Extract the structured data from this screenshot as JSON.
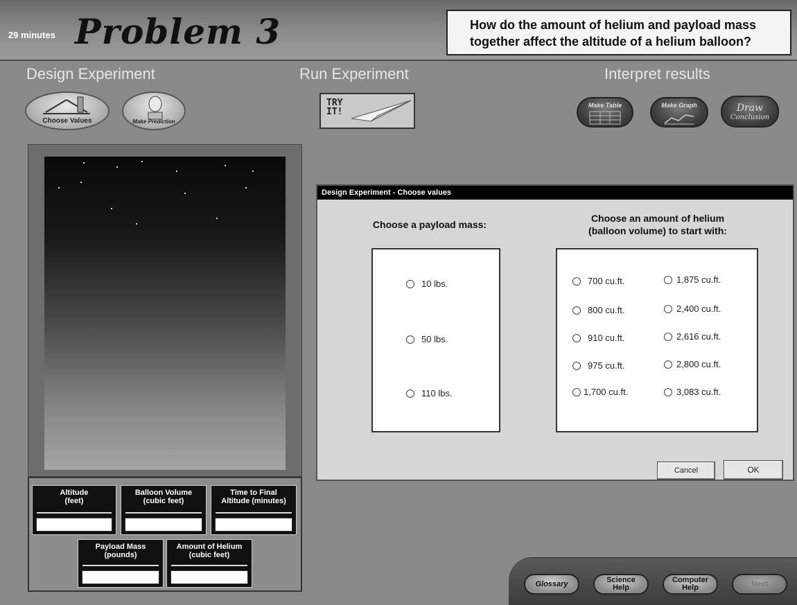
{
  "header": {
    "timer": "29 minutes",
    "title": "Problem 3",
    "question_line1": "How do the amount of helium and payload mass",
    "question_line2": "together affect the altitude of a helium balloon?"
  },
  "sections": {
    "design": {
      "title": "Design  Experiment",
      "choose_values": "Choose Values",
      "make_prediction": "Make Prediction"
    },
    "run": {
      "title": "Run  Experiment",
      "try_it_line1": "TRY",
      "try_it_line2": "IT!"
    },
    "interpret": {
      "title": "Interpret results",
      "make_table": "Make Table",
      "make_graph": "Make Graph",
      "draw_conclusion_line1": "Draw",
      "draw_conclusion_line2": "Conclusion"
    }
  },
  "readouts": {
    "altitude": {
      "line1": "Altitude",
      "line2": "(feet)",
      "value": ""
    },
    "balloon_volume": {
      "line1": "Balloon Volume",
      "line2": "(cubic feet)",
      "value": ""
    },
    "time_to_final": {
      "line1": "Time to Final",
      "line2": "Altitude (minutes)",
      "value": ""
    },
    "payload_mass": {
      "line1": "Payload Mass",
      "line2": "(pounds)",
      "value": ""
    },
    "amount_of_helium": {
      "line1": "Amount of Helium",
      "line2": "(cubic feet)",
      "value": ""
    }
  },
  "dialog": {
    "title": "Design Experiment - Choose values",
    "payload_heading": "Choose a payload mass:",
    "helium_heading_line1": "Choose an amount of helium",
    "helium_heading_line2": "(balloon volume) to start with:",
    "payload_options": [
      "10 lbs.",
      "50 lbs.",
      "110 lbs."
    ],
    "helium_options_col1": [
      "700 cu.ft.",
      "800 cu.ft.",
      "910 cu.ft.",
      "975 cu.ft.",
      "1,700 cu.ft."
    ],
    "helium_options_col2": [
      "1,875 cu.ft.",
      "2,400 cu.ft.",
      "2,616 cu.ft.",
      "2,800 cu.ft.",
      "3,083 cu.ft."
    ],
    "cancel": "Cancel",
    "ok": "OK"
  },
  "nav": {
    "glossary": "Glossary",
    "science_help_line1": "Science",
    "science_help_line2": "Help",
    "computer_help_line1": "Computer",
    "computer_help_line2": "Help",
    "next": "Next"
  }
}
